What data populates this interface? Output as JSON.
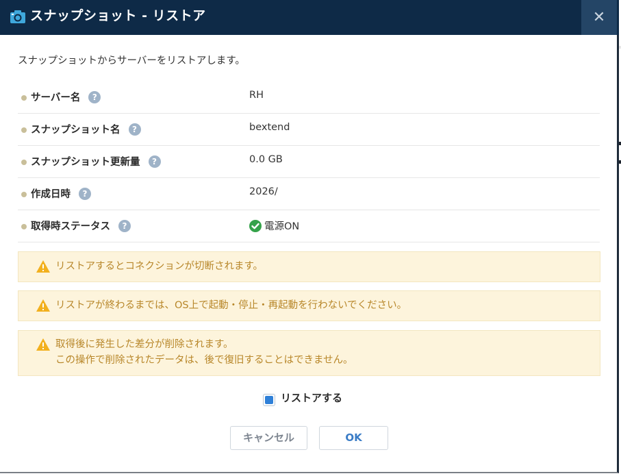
{
  "dialog": {
    "title": "スナップショット - リストア",
    "title_icon": "camera-icon",
    "close_label": "✕",
    "intro": "スナップショットからサーバーをリストアします。"
  },
  "fields": [
    {
      "label": "サーバー名",
      "value": "RH"
    },
    {
      "label": "スナップショット名",
      "value": "bextend"
    },
    {
      "label": "スナップショット更新量",
      "value": "0.0 GB"
    },
    {
      "label": "作成日時",
      "value": "2026/"
    },
    {
      "label": "取得時ステータス",
      "value": "電源ON",
      "status_icon": "check-circle-icon"
    }
  ],
  "help_glyph": "?",
  "warnings": [
    {
      "line1": "リストアするとコネクションが切断されます。",
      "line2": ""
    },
    {
      "line1": "リストアが終わるまでは、OS上で起動・停止・再起動を行わないでください。",
      "line2": ""
    },
    {
      "line1": "取得後に発生した差分が削除されます。",
      "line2": "この操作で削除されたデータは、後で復旧することはできません。"
    }
  ],
  "confirm": {
    "label": "リストアする",
    "checked": true
  },
  "buttons": {
    "cancel": "キャンセル",
    "ok": "OK"
  },
  "colors": {
    "titlebar": "#0e2a47",
    "close_bg": "#244566",
    "warn_bg": "#fdf4dc",
    "warn_text": "#b8872a",
    "check_green": "#35a24a",
    "checkbox_blue": "#2f80d8",
    "ok_text": "#3a7cc6"
  }
}
